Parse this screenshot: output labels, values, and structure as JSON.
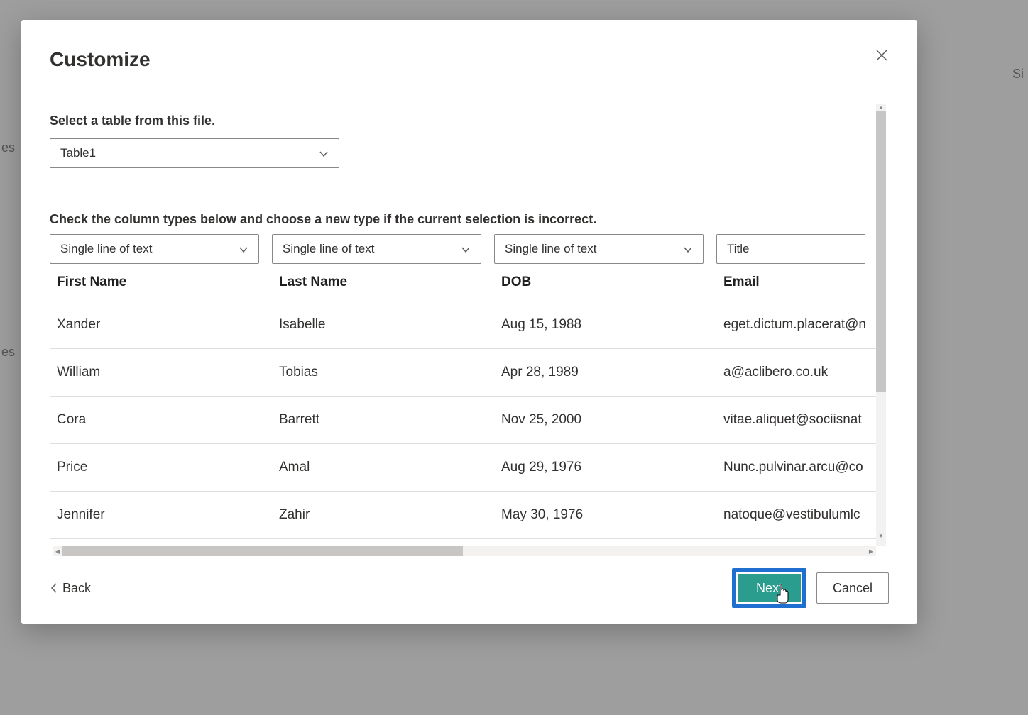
{
  "bg": {
    "es1": "es",
    "es2": "es",
    "si": "Si"
  },
  "modal": {
    "title": "Customize",
    "tableSelectLabel": "Select a table from this file.",
    "tableSelectValue": "Table1",
    "columnTypesLabel": "Check the column types below and choose a new type if the current selection is incorrect.",
    "columnTypes": [
      "Single line of text",
      "Single line of text",
      "Single line of text",
      "Title"
    ],
    "columns": [
      "First Name",
      "Last Name",
      "DOB",
      "Email"
    ],
    "rows": [
      {
        "firstName": "Xander",
        "lastName": "Isabelle",
        "dob": "Aug 15, 1988",
        "email": "eget.dictum.placerat@n"
      },
      {
        "firstName": "William",
        "lastName": "Tobias",
        "dob": "Apr 28, 1989",
        "email": "a@aclibero.co.uk"
      },
      {
        "firstName": "Cora",
        "lastName": "Barrett",
        "dob": "Nov 25, 2000",
        "email": "vitae.aliquet@sociisnat"
      },
      {
        "firstName": "Price",
        "lastName": "Amal",
        "dob": "Aug 29, 1976",
        "email": "Nunc.pulvinar.arcu@co"
      },
      {
        "firstName": "Jennifer",
        "lastName": "Zahir",
        "dob": "May 30, 1976",
        "email": "natoque@vestibulumlc"
      }
    ],
    "back": "Back",
    "next": "Next",
    "cancel": "Cancel"
  }
}
